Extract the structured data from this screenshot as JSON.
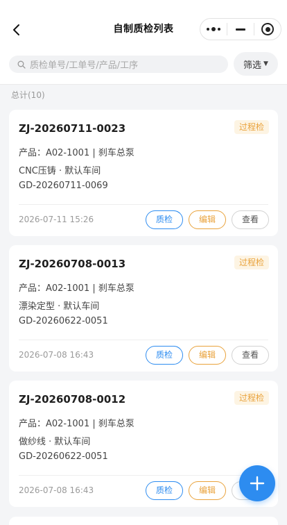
{
  "nav": {
    "title": "自制质检列表"
  },
  "search": {
    "placeholder": "质检单号/工单号/产品/工序",
    "filter_label": "筛选"
  },
  "total_label": "总计(10)",
  "icons": {
    "back": "chevron-left-icon",
    "more": "more-dots-icon",
    "minimize": "minus-icon",
    "close": "target-circle-icon",
    "search": "search-icon",
    "filter_caret": "caret-down-icon",
    "add": "plus-icon"
  },
  "colors": {
    "primary": "#2d8cf0",
    "warning": "#e9a23b",
    "tag_bg": "#fdf4e3"
  },
  "buttons": {
    "inspect": "质检",
    "edit": "编辑",
    "view": "查看"
  },
  "cards": [
    {
      "code": "ZJ-20260711-0023",
      "tag": "过程检",
      "product": "产品：A02-1001 | 刹车总泵",
      "process": "CNC压铸 · 默认车间",
      "work_order": "GD-20260711-0069",
      "date": "2026-07-11 15:26"
    },
    {
      "code": "ZJ-20260708-0013",
      "tag": "过程检",
      "product": "产品：A02-1001 | 刹车总泵",
      "process": "漂染定型 · 默认车间",
      "work_order": "GD-20260622-0051",
      "date": "2026-07-08 16:43"
    },
    {
      "code": "ZJ-20260708-0012",
      "tag": "过程检",
      "product": "产品：A02-1001 | 刹车总泵",
      "process": "做纱线 · 默认车间",
      "work_order": "GD-20260622-0051",
      "date": "2026-07-08 16:43"
    }
  ]
}
